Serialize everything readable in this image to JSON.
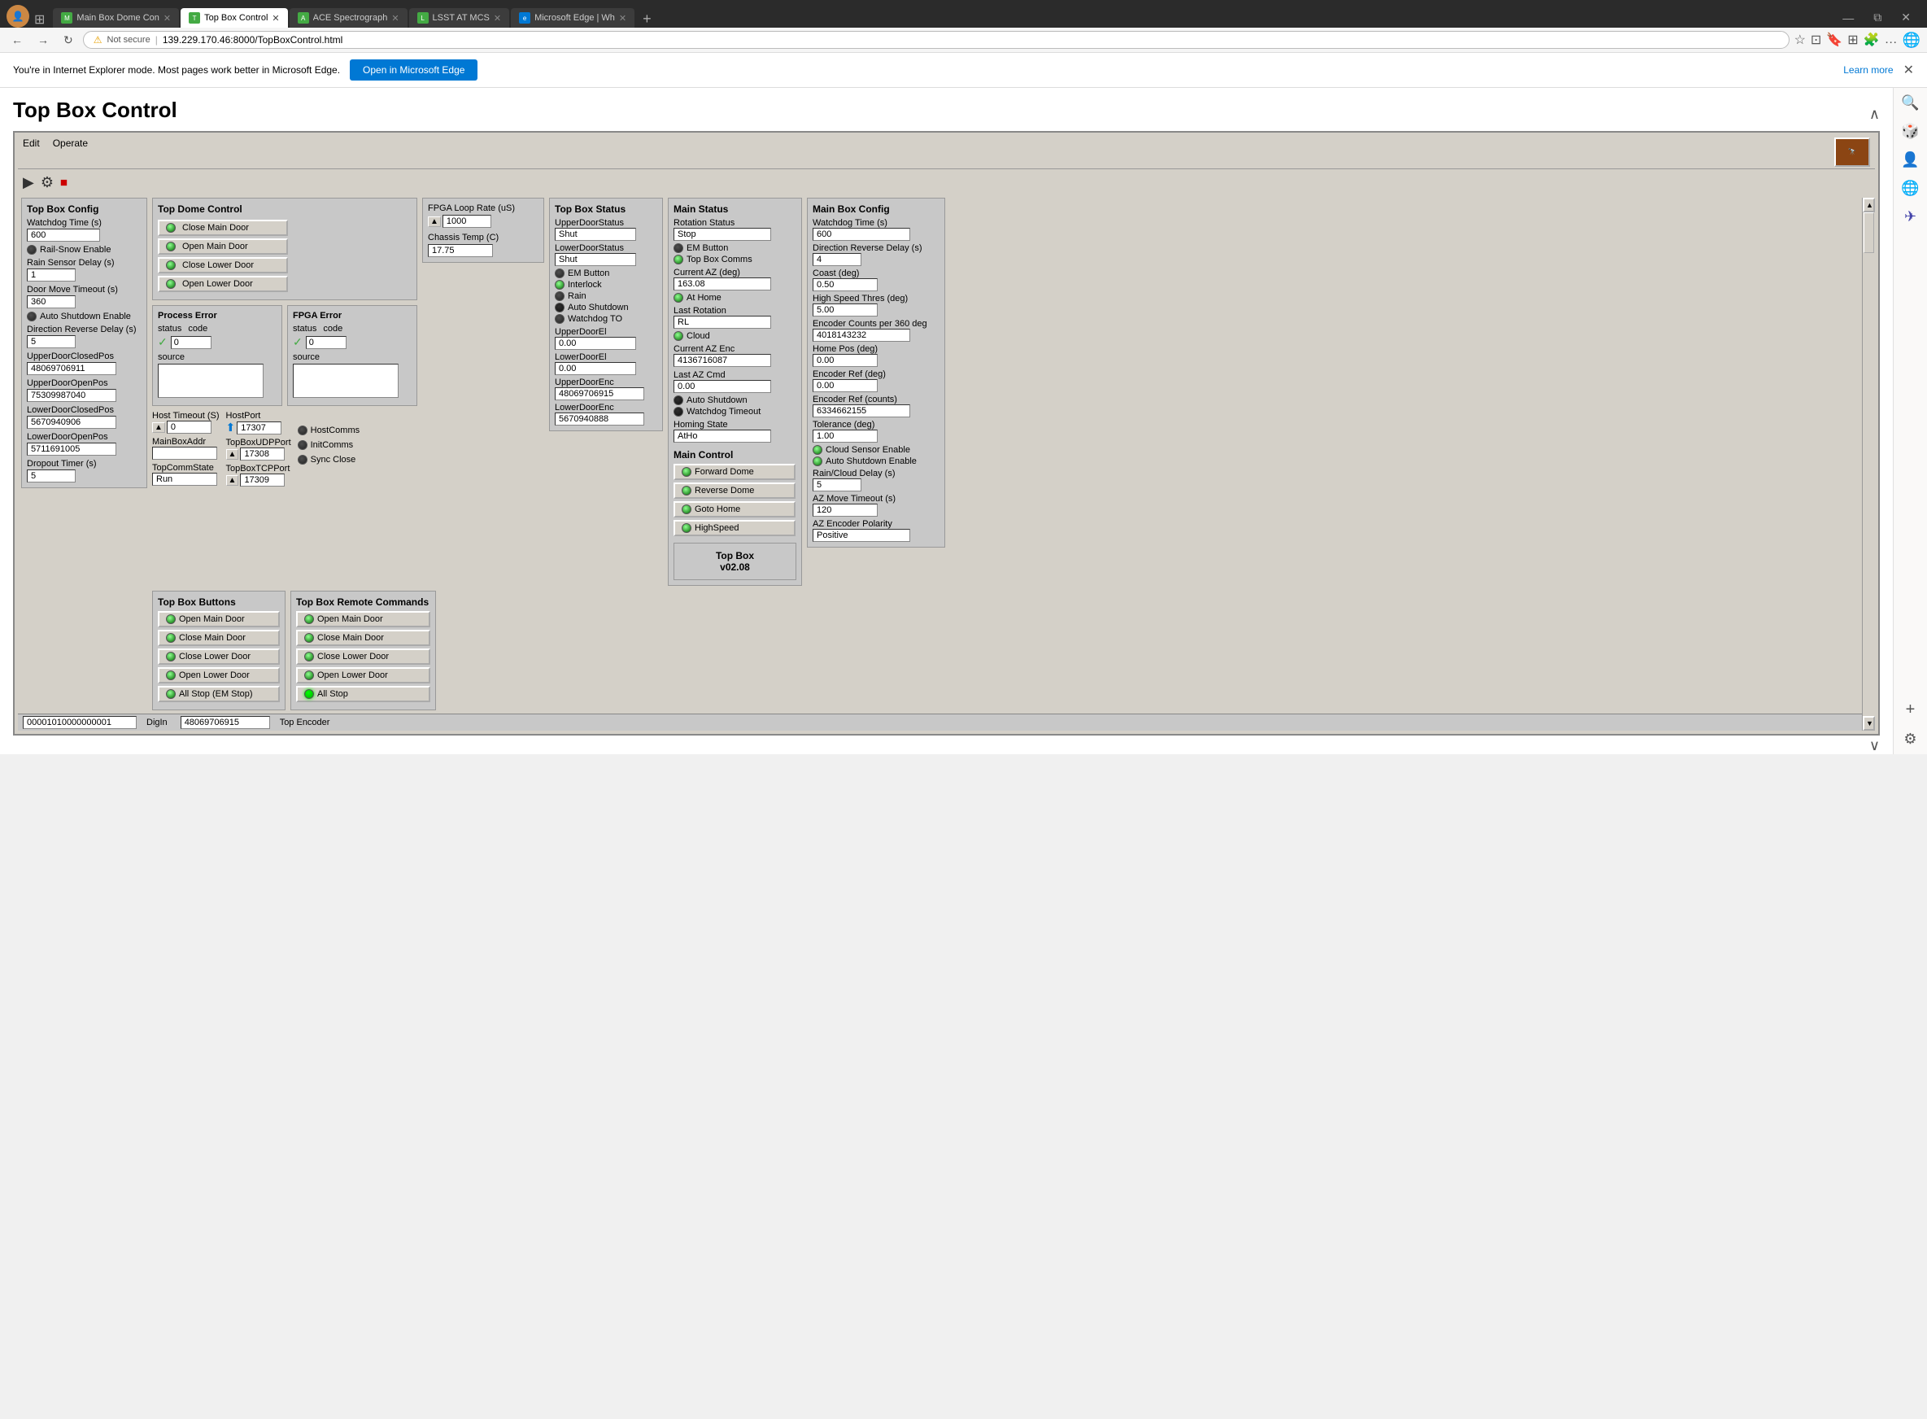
{
  "browser": {
    "tabs": [
      {
        "label": "Main Box Dome Con",
        "active": false,
        "favicon": "M"
      },
      {
        "label": "Top Box Control",
        "active": true,
        "favicon": "T"
      },
      {
        "label": "ACE Spectrograph",
        "active": false,
        "favicon": "A"
      },
      {
        "label": "LSST AT MCS",
        "active": false,
        "favicon": "L"
      },
      {
        "label": "Microsoft Edge | Wh",
        "active": false,
        "favicon": "E"
      }
    ],
    "address": "139.229.170.46:8000/TopBoxControl.html",
    "security": "Not secure",
    "ie_banner": "You're in Internet Explorer mode. Most pages work better in Microsoft Edge.",
    "ie_button": "Open in Microsoft Edge",
    "ie_learn": "Learn more"
  },
  "page": {
    "title": "Top Box Control"
  },
  "menu": {
    "edit": "Edit",
    "operate": "Operate"
  },
  "top_box_config": {
    "title": "Top Box Config",
    "watchdog_label": "Watchdog Time (s)",
    "watchdog_val": "600",
    "rail_snow_label": "Rail-Snow Enable",
    "rain_sensor_label": "Rain Sensor Delay (s)",
    "rain_sensor_val": "1",
    "door_move_label": "Door Move Timeout (s)",
    "door_move_val": "360",
    "auto_shutdown_label": "Auto Shutdown Enable",
    "direction_reverse_label": "Direction Reverse Delay (s)",
    "direction_reverse_val": "5",
    "upper_door_closed_label": "UpperDoorClosedPos",
    "upper_door_closed_val": "48069706911",
    "upper_door_open_label": "UpperDoorOpenPos",
    "upper_door_open_val": "75309987040",
    "lower_door_closed_label": "LowerDoorClosedPos",
    "lower_door_closed_val": "5670940906",
    "lower_door_open_label": "LowerDoorOpenPos",
    "lower_door_open_val": "5711691005",
    "dropout_timer_label": "Dropout Timer (s)",
    "dropout_timer_val": "5"
  },
  "top_dome_control": {
    "title": "Top Dome Control",
    "buttons": [
      "Close Main Door",
      "Open Main Door",
      "Close Lower Door",
      "Open Lower Door"
    ]
  },
  "fpga": {
    "loop_rate_label": "FPGA Loop Rate (uS)",
    "loop_rate_val": "1000",
    "chassis_temp_label": "Chassis Temp (C)",
    "chassis_temp_val": "17.75"
  },
  "process_error": {
    "title": "Process Error",
    "status_label": "status",
    "code_label": "code",
    "code_val": "0",
    "source_label": "source",
    "source_val": ""
  },
  "fpga_error": {
    "title": "FPGA Error",
    "status_label": "status",
    "code_label": "code",
    "code_val": "0",
    "source_label": "source",
    "source_val": ""
  },
  "host": {
    "timeout_label": "Host Timeout (S)",
    "timeout_val": "0",
    "main_box_addr_label": "MainBoxAddr",
    "main_box_addr_val": "",
    "host_port_label": "HostPort",
    "host_port_val": "17307",
    "udp_port_label": "TopBoxUDPPort",
    "udp_port_val": "17308",
    "tcp_port_label": "TopBoxTCPPort",
    "tcp_port_val": "17309",
    "top_comm_state_label": "TopCommState",
    "top_comm_state_val": "Run"
  },
  "comm_status": {
    "host_comms_label": "HostComms",
    "init_comms_label": "InitComms",
    "sync_close_label": "Sync Close"
  },
  "top_box_status": {
    "title": "Top Box Status",
    "items": [
      {
        "label": "UpperDoorStatus",
        "val": "Shut",
        "led": "gray"
      },
      {
        "label": "LowerDoorStatus",
        "val": "Shut",
        "led": "gray"
      },
      {
        "label": "EM Button",
        "led": "gray"
      },
      {
        "label": "Interlock",
        "led": "green"
      },
      {
        "label": "Rain",
        "led": "gray"
      },
      {
        "label": "Auto Shutdown",
        "led": "dark"
      },
      {
        "label": "Watchdog TO",
        "led": "gray"
      },
      {
        "label": "UpperDoorEl",
        "val": "0.00"
      },
      {
        "label": "LowerDoorEl",
        "val": "0.00"
      },
      {
        "label": "UpperDoorEnc",
        "val": "48069706915"
      },
      {
        "label": "LowerDoorEnc",
        "val": "5670940888"
      }
    ]
  },
  "main_status": {
    "title": "Main Status",
    "rotation_status_label": "Rotation Status",
    "rotation_status_val": "Stop",
    "em_button_label": "EM Button",
    "top_box_comms_label": "Top Box Comms",
    "current_az_label": "Current AZ (deg)",
    "current_az_val": "163.08",
    "at_home_label": "At Home",
    "last_rotation_label": "Last Rotation",
    "last_rotation_val": "RL",
    "cloud_label": "Cloud",
    "current_az_enc_label": "Current AZ Enc",
    "current_az_enc_val": "4136716087",
    "last_az_cmd_label": "Last AZ Cmd",
    "last_az_cmd_val": "0.00",
    "auto_shutdown_label": "Auto Shutdown",
    "watchdog_timeout_label": "Watchdog Timeout",
    "homing_state_label": "Homing State",
    "homing_state_val": "AtHo",
    "leds": {
      "em_button": "gray",
      "top_box_comms": "green",
      "at_home": "green",
      "cloud": "green",
      "auto_shutdown": "dark",
      "watchdog_timeout": "dark"
    }
  },
  "main_control": {
    "title": "Main Control",
    "buttons": [
      {
        "label": "Forward Dome",
        "led": "green"
      },
      {
        "label": "Reverse Dome",
        "led": "green"
      },
      {
        "label": "Goto Home",
        "led": "green"
      },
      {
        "label": "HighSpeed",
        "led": "green"
      }
    ]
  },
  "top_box_version": {
    "label": "Top Box",
    "version": "v02.08"
  },
  "main_box_config": {
    "title": "Main Box Config",
    "watchdog_label": "Watchdog Time (s)",
    "watchdog_val": "600",
    "dir_reverse_label": "Direction Reverse Delay (s)",
    "dir_reverse_val": "4",
    "coast_label": "Coast (deg)",
    "coast_val": "0.50",
    "high_speed_label": "High Speed Thres (deg)",
    "high_speed_val": "5.00",
    "encoder_counts_label": "Encoder Counts per 360 deg",
    "encoder_counts_val": "4018143232",
    "home_pos_label": "Home Pos (deg)",
    "home_pos_val": "0.00",
    "encoder_ref_deg_label": "Encoder Ref (deg)",
    "encoder_ref_deg_val": "0.00",
    "encoder_ref_counts_label": "Encoder Ref (counts)",
    "encoder_ref_counts_val": "6334662155",
    "tolerance_label": "Tolerance (deg)",
    "tolerance_val": "1.00",
    "cloud_sensor_label": "Cloud Sensor Enable",
    "auto_shutdown_label": "Auto Shutdown Enable",
    "rain_cloud_delay_label": "Rain/Cloud Delay (s)",
    "rain_cloud_delay_val": "5",
    "az_move_timeout_label": "AZ Move Timeout (s)",
    "az_move_timeout_val": "120",
    "az_encoder_polarity_label": "AZ Encoder Polarity",
    "az_encoder_polarity_val": "Positive",
    "leds": {
      "cloud_sensor": "green",
      "auto_shutdown": "green"
    }
  },
  "top_box_buttons": {
    "title": "Top Box Buttons",
    "buttons": [
      {
        "label": "Open Main Door",
        "led": "green"
      },
      {
        "label": "Close Main Door",
        "led": "green"
      },
      {
        "label": "Close Lower Door",
        "led": "green"
      },
      {
        "label": "Open Lower Door",
        "led": "green"
      },
      {
        "label": "All Stop (EM Stop)",
        "led": "green"
      }
    ]
  },
  "top_box_remote": {
    "title": "Top Box Remote Commands",
    "buttons": [
      {
        "label": "Open Main Door",
        "led": "green"
      },
      {
        "label": "Close Main Door",
        "led": "green"
      },
      {
        "label": "Close Lower Door",
        "led": "green"
      },
      {
        "label": "Open Lower Door",
        "led": "green"
      },
      {
        "label": "All Stop",
        "led": "bright-green"
      }
    ]
  },
  "status_bar": {
    "dig_in_val": "00001010000000001",
    "dig_in_label": "DigIn",
    "top_encoder_val": "48069706915",
    "top_encoder_label": "Top Encoder"
  }
}
